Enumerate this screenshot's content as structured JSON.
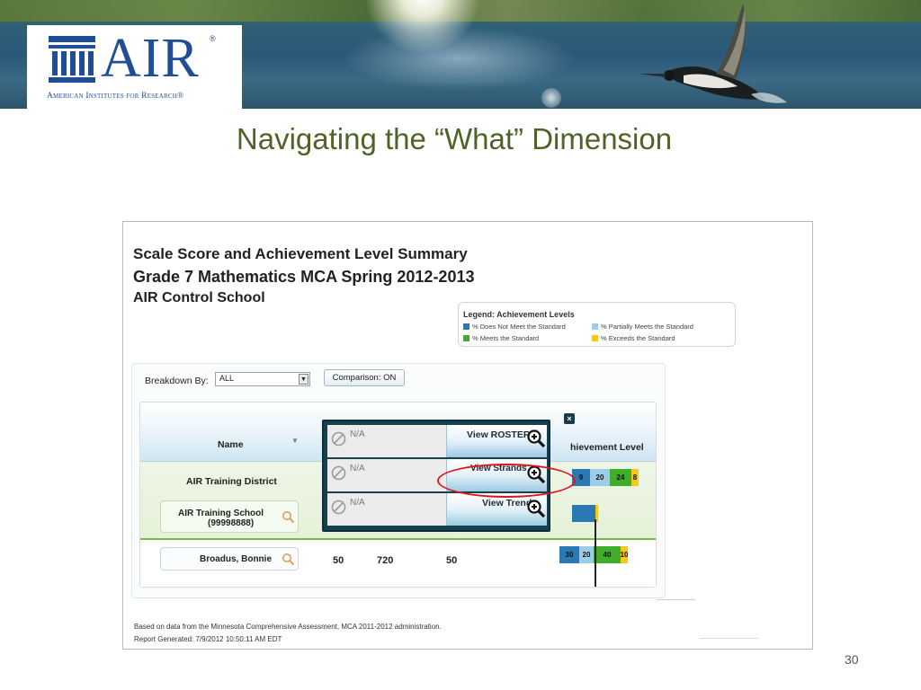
{
  "logo": {
    "wordmark": "AIR",
    "registered": "®",
    "tagline": "American Institutes for Research®"
  },
  "slide": {
    "title": "Navigating the “What” Dimension",
    "page_number": "30"
  },
  "report": {
    "title": "Scale Score and Achievement Level Summary",
    "subtitle": "Grade 7 Mathematics MCA Spring 2012-2013",
    "school": "AIR Control School",
    "legend": {
      "title": "Legend: Achievement Levels",
      "items": [
        {
          "label": "% Does Not Meet the Standard",
          "color": "#2a79b5"
        },
        {
          "label": "% Partially Meets the Standard",
          "color": "#9dcbea"
        },
        {
          "label": "% Meets the Standard",
          "color": "#3fae2a"
        },
        {
          "label": "% Exceeds the Standard",
          "color": "#f5c81b"
        }
      ]
    },
    "breakdown": {
      "label": "Breakdown By:",
      "value": "ALL",
      "comparison_label": "Comparison: ON"
    },
    "table": {
      "col_name": "Name",
      "col_achievement": "hievement Level",
      "district": {
        "name": "AIR Training District",
        "bar": [
          {
            "label": "9",
            "color": "#2a79b5"
          },
          {
            "label": "20",
            "color": "#9dcbea"
          },
          {
            "label": "24",
            "color": "#3fae2a"
          },
          {
            "label": "8",
            "color": "#f5c81b"
          }
        ]
      },
      "school": {
        "name": "AIR Training School",
        "id": "(99998888)"
      },
      "student": {
        "name": "Broadus, Bonnie",
        "values": [
          "50",
          "720",
          "50"
        ],
        "bar": [
          {
            "label": "30",
            "color": "#2a79b5"
          },
          {
            "label": "20",
            "color": "#9dcbea"
          },
          {
            "label": "40",
            "color": "#3fae2a"
          },
          {
            "label": "10",
            "color": "#f5c81b"
          }
        ]
      }
    },
    "popup": {
      "close": "×",
      "rows": [
        {
          "na": "N/A",
          "action": "View ROSTER"
        },
        {
          "na": "N/A",
          "action": "View Strands"
        },
        {
          "na": "N/A",
          "action": "View Trend"
        }
      ]
    },
    "footer": {
      "source": "Based on data from the Minnesota Comprehensive Assessment, MCA 2011-2012 administration.",
      "generated": "Report Generated: 7/9/2012 10:50:11 AM EDT"
    }
  },
  "colors": {
    "title_green": "#4f6228",
    "brand_blue": "#1f4e96",
    "highlight_red": "#e0141a"
  }
}
